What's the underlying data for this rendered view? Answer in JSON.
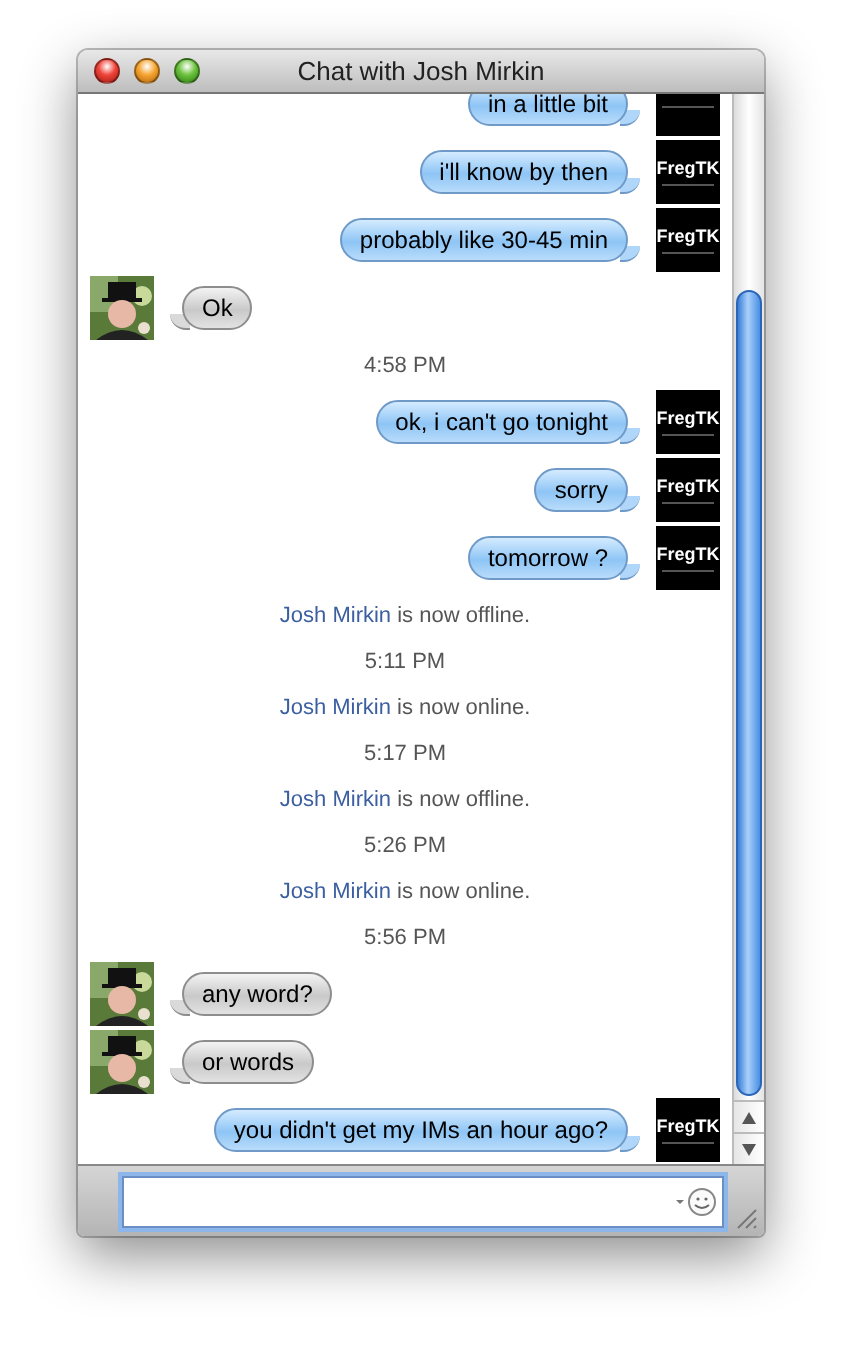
{
  "window": {
    "title": "Chat with Josh Mirkin"
  },
  "messages": [
    {
      "kind": "sent",
      "text": "in a little bit"
    },
    {
      "kind": "sent",
      "text": "i'll know by then",
      "avatar": "FregTK"
    },
    {
      "kind": "sent",
      "text": "probably like 30-45 min",
      "avatar": "FregTK"
    },
    {
      "kind": "received",
      "text": "Ok"
    },
    {
      "kind": "time",
      "text": "4:58 PM"
    },
    {
      "kind": "sent",
      "text": "ok, i can't go tonight",
      "avatar": "FregTK"
    },
    {
      "kind": "sent",
      "text": "sorry",
      "avatar": "FregTK"
    },
    {
      "kind": "sent",
      "text": "tomorrow ?",
      "avatar": "FregTK"
    },
    {
      "kind": "status",
      "name": "Josh Mirkin",
      "text": "is now offline."
    },
    {
      "kind": "time",
      "text": "5:11 PM"
    },
    {
      "kind": "status",
      "name": "Josh Mirkin",
      "text": "is now online."
    },
    {
      "kind": "time",
      "text": "5:17 PM"
    },
    {
      "kind": "status",
      "name": "Josh Mirkin",
      "text": "is now offline."
    },
    {
      "kind": "time",
      "text": "5:26 PM"
    },
    {
      "kind": "status",
      "name": "Josh Mirkin",
      "text": "is now online."
    },
    {
      "kind": "time",
      "text": "5:56 PM"
    },
    {
      "kind": "received",
      "text": "any word?"
    },
    {
      "kind": "received",
      "text": "or words"
    },
    {
      "kind": "sent",
      "text": "you didn't get my IMs an hour ago?",
      "avatar": "FregTK"
    }
  ]
}
